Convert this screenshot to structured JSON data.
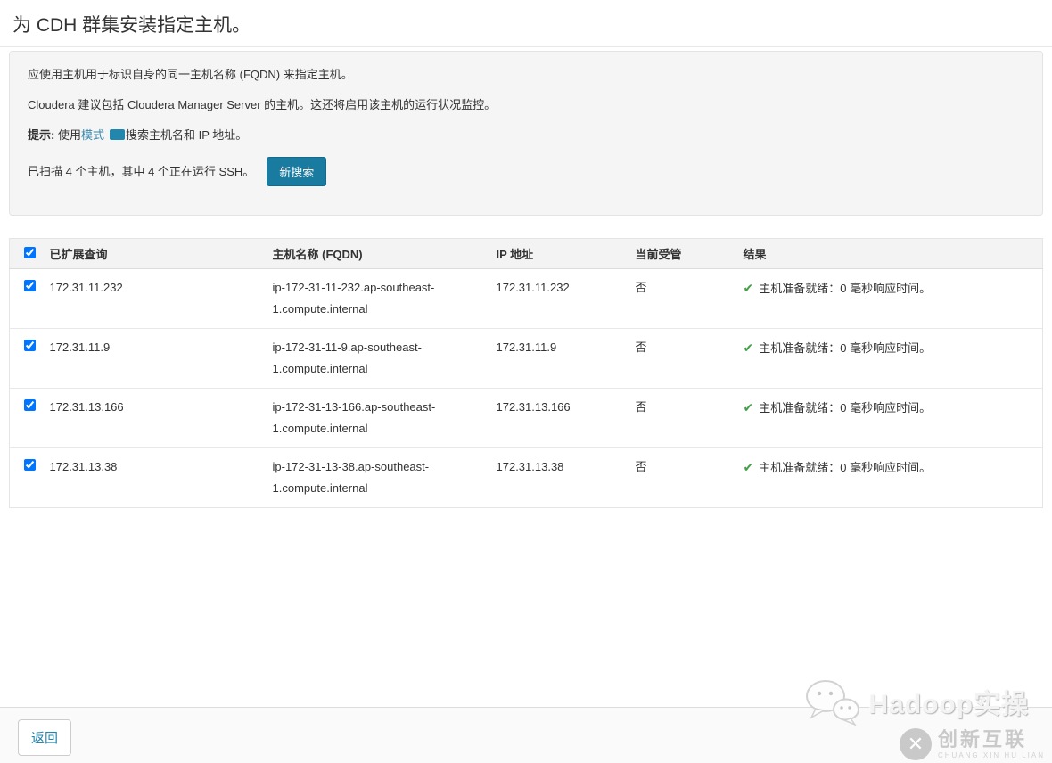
{
  "page": {
    "title": "为 CDH 群集安装指定主机。"
  },
  "info_box": {
    "line1": "应使用主机用于标识自身的同一主机名称 (FQDN) 来指定主机。",
    "line2": "Cloudera 建议包括 Cloudera Manager Server 的主机。这还将启用该主机的运行状况监控。",
    "tip_label": "提示:",
    "tip_pre": " 使用",
    "tip_link": "模式",
    "tip_post": "搜索主机名和 IP 地址。",
    "scan_status": "已扫描 4 个主机，其中 4 个正在运行 SSH。",
    "new_search_button": "新搜索"
  },
  "table": {
    "select_all_checked": true,
    "headers": [
      "已扩展查询",
      "主机名称 (FQDN)",
      "IP 地址",
      "当前受管",
      "结果"
    ],
    "rows": [
      {
        "checked": true,
        "query": "172.31.11.232",
        "fqdn": "ip-172-31-11-232.ap-southeast-1.compute.internal",
        "ip": "172.31.11.232",
        "managed": "否",
        "result": "主机准备就绪：0 毫秒响应时间。"
      },
      {
        "checked": true,
        "query": "172.31.11.9",
        "fqdn": "ip-172-31-11-9.ap-southeast-1.compute.internal",
        "ip": "172.31.11.9",
        "managed": "否",
        "result": "主机准备就绪：0 毫秒响应时间。"
      },
      {
        "checked": true,
        "query": "172.31.13.166",
        "fqdn": "ip-172-31-13-166.ap-southeast-1.compute.internal",
        "ip": "172.31.13.166",
        "managed": "否",
        "result": "主机准备就绪：0 毫秒响应时间。"
      },
      {
        "checked": true,
        "query": "172.31.13.38",
        "fqdn": "ip-172-31-13-38.ap-southeast-1.compute.internal",
        "ip": "172.31.13.38",
        "managed": "否",
        "result": "主机准备就绪：0 毫秒响应时间。"
      }
    ]
  },
  "footer": {
    "back_button": "返回"
  },
  "watermarks": {
    "hadoop_text": "Hadoop实操",
    "brand_x": "✕",
    "brand_name": "创新互联",
    "brand_sub": "CHUANG XIN HU LIAN"
  },
  "icons": {
    "check": "✔"
  },
  "colors": {
    "primary_button": "#1a7ba1",
    "link": "#3788ab",
    "success_check": "#43a047",
    "info_box_bg": "#f5f5f5",
    "header_bg": "#f3f3f3"
  }
}
